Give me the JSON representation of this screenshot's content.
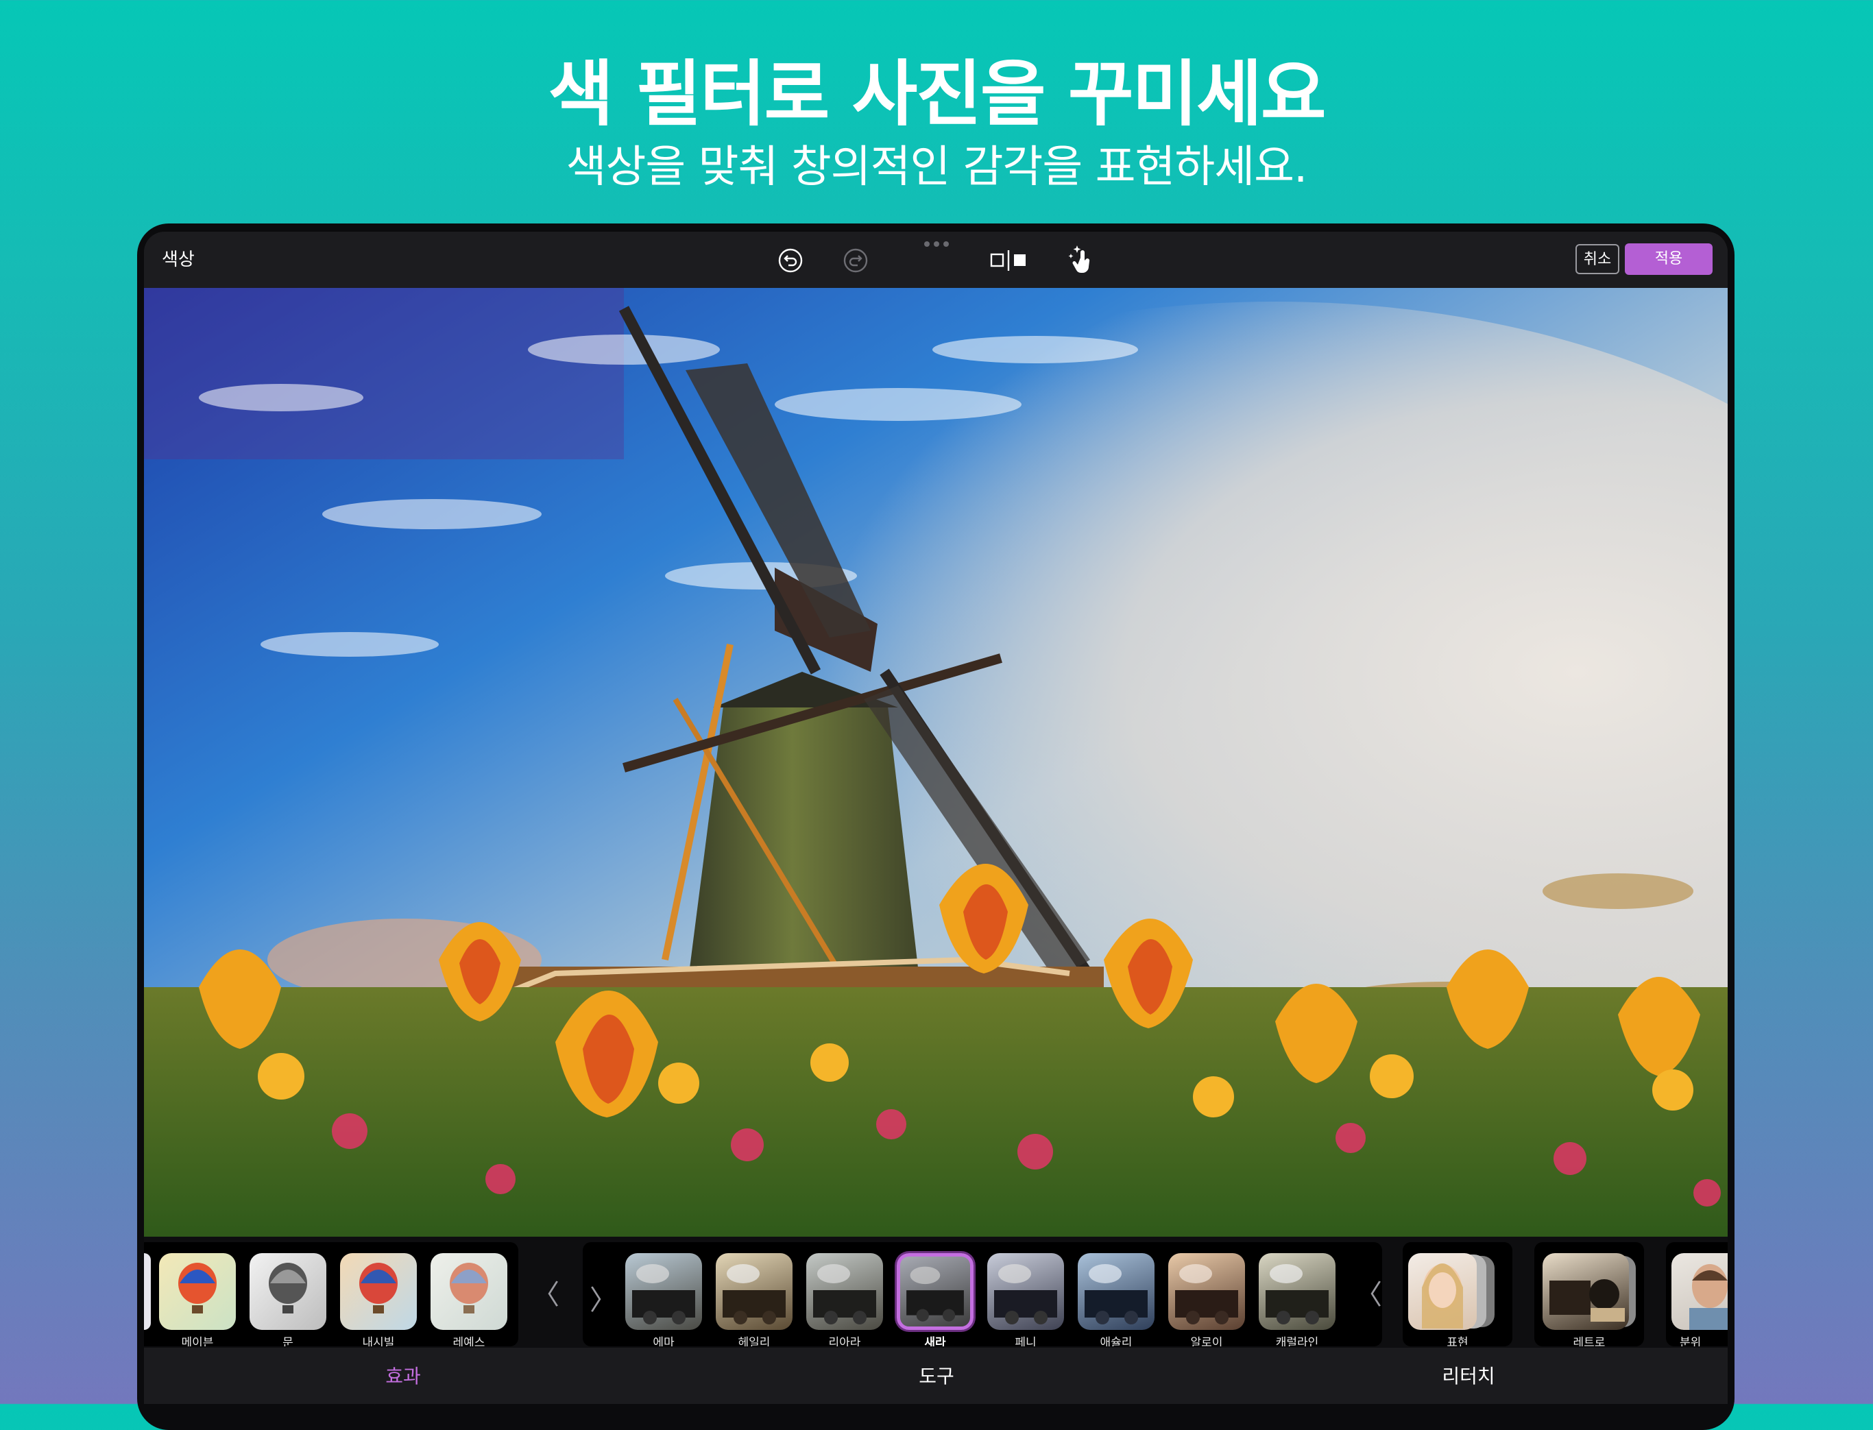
{
  "promo": {
    "headline": "색 필터로 사진을 꾸미세요",
    "subheadline": "색상을 맞춰 창의적인 감각을 표현하세요."
  },
  "toolbar": {
    "title": "색상",
    "cancel_label": "취소",
    "apply_label": "적용",
    "icons": [
      "undo-icon",
      "redo-icon",
      "compare-icon",
      "magic-touch-icon"
    ],
    "accent_color": "#b45fd4"
  },
  "filters": {
    "group1": [
      "메이븐",
      "문",
      "내시빌",
      "레예스"
    ],
    "group2": [
      "에마",
      "헤일리",
      "리아라",
      "새라",
      "페니",
      "애슐리",
      "알로이",
      "캐럴라인"
    ],
    "selected": "새라",
    "categories": [
      "표현",
      "레트로",
      "분위"
    ]
  },
  "tabs": {
    "effects": "효과",
    "tools": "도구",
    "retouch": "리터치",
    "active": "효과"
  }
}
